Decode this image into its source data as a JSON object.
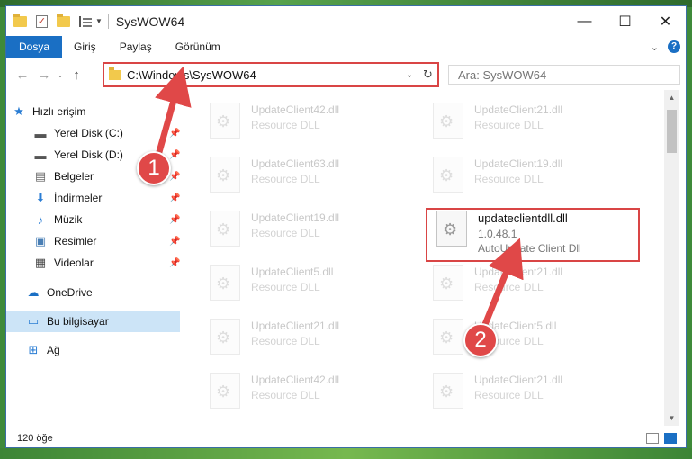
{
  "window": {
    "title": "SysWOW64",
    "minimize": "—",
    "maximize": "☐",
    "close": "✕"
  },
  "ribbon": {
    "tabs": [
      "Dosya",
      "Giriş",
      "Paylaş",
      "Görünüm"
    ],
    "active_tab": "Dosya",
    "help": "?"
  },
  "nav": {
    "back": "←",
    "forward": "→",
    "up": "↑",
    "address": "C:\\Windows\\SysWOW64",
    "search_placeholder": "Ara: SysWOW64"
  },
  "sidebar": {
    "items": [
      {
        "label": "Hızlı erişim",
        "icon": "star-icon",
        "pinned": false
      },
      {
        "label": "Yerel Disk (C:)",
        "icon": "drive-icon",
        "pinned": true
      },
      {
        "label": "Yerel Disk (D:)",
        "icon": "drive-icon",
        "pinned": true
      },
      {
        "label": "Belgeler",
        "icon": "document-icon",
        "pinned": true
      },
      {
        "label": "İndirmeler",
        "icon": "download-icon",
        "pinned": true
      },
      {
        "label": "Müzik",
        "icon": "music-icon",
        "pinned": true
      },
      {
        "label": "Resimler",
        "icon": "pictures-icon",
        "pinned": true
      },
      {
        "label": "Videolar",
        "icon": "video-icon",
        "pinned": true
      },
      {
        "label": "OneDrive",
        "icon": "cloud-icon",
        "pinned": false
      },
      {
        "label": "Bu bilgisayar",
        "icon": "computer-icon",
        "pinned": false
      },
      {
        "label": "Ağ",
        "icon": "network-icon",
        "pinned": false
      }
    ],
    "selected": "Bu bilgisayar"
  },
  "files": {
    "left": [
      {
        "name": "UpdateClient42.dll",
        "type": "Resource DLL"
      },
      {
        "name": "UpdateClient63.dll",
        "type": "Resource DLL"
      },
      {
        "name": "UpdateClient19.dll",
        "type": "Resource DLL"
      },
      {
        "name": "UpdateClient5.dll",
        "type": "Resource DLL"
      },
      {
        "name": "UpdateClient21.dll",
        "type": "Resource DLL"
      },
      {
        "name": "UpdateClient42.dll",
        "type": "Resource DLL"
      }
    ],
    "right": [
      {
        "name": "UpdateClient21.dll",
        "type": "Resource DLL"
      },
      {
        "name": "UpdateClient19.dll",
        "type": "Resource DLL"
      },
      {
        "name": "UpdateClient21.dll",
        "type": "Resource DLL"
      },
      {
        "name": "UpdateClient5.dll",
        "type": "Resource DLL"
      },
      {
        "name": "UpdateClient21.dll",
        "type": "Resource DLL"
      }
    ],
    "highlighted": {
      "name": "updateclientdll.dll",
      "version": "1.0.48.1",
      "description": "AutoUpdate Client Dll"
    }
  },
  "status": {
    "count": "120 öğe"
  },
  "annotations": {
    "step1": "1",
    "step2": "2",
    "color": "#e04848"
  }
}
